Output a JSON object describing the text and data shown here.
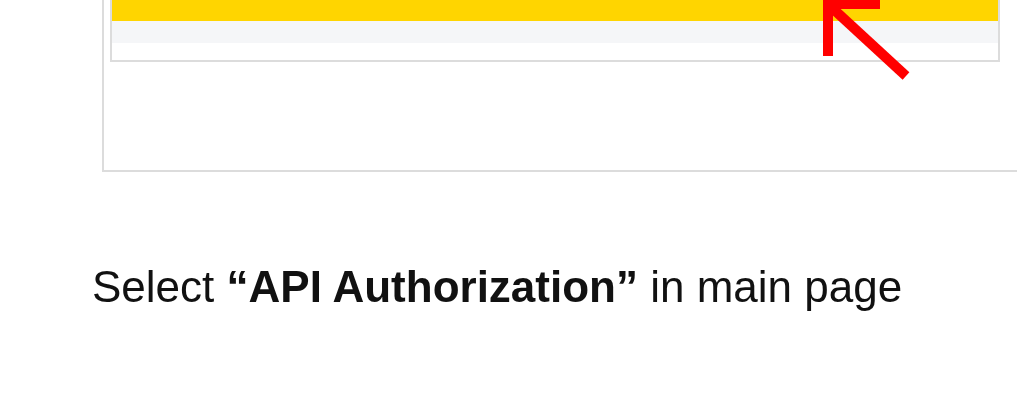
{
  "step_text": "Select **“API Authorization”** in main page"
}
